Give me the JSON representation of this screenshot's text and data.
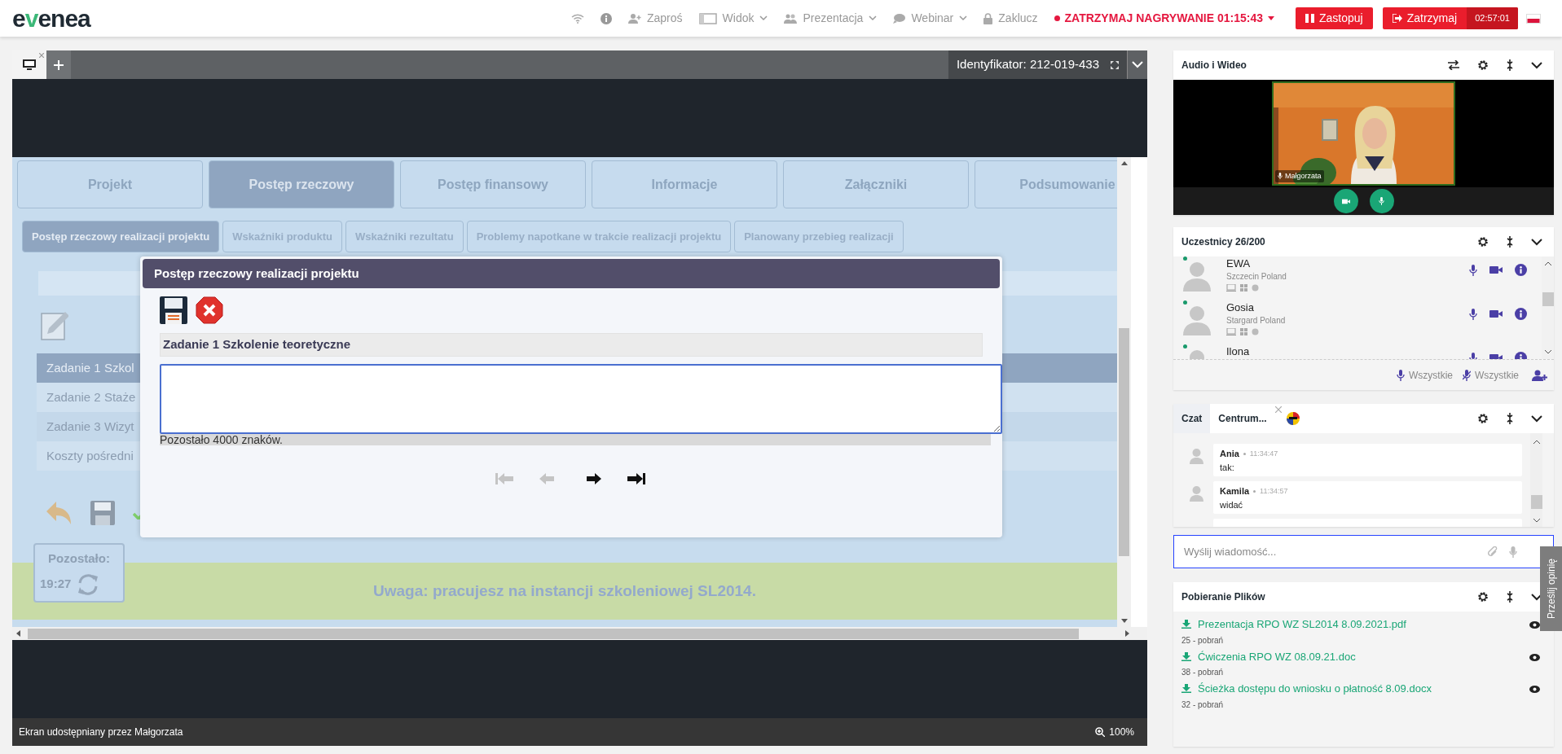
{
  "header": {
    "logo": [
      {
        "text": "e",
        "accent": false
      },
      {
        "text": "v",
        "accent": true
      },
      {
        "text": "enea",
        "accent": false
      }
    ],
    "nav": [
      {
        "kind": "wifi"
      },
      {
        "kind": "info"
      },
      {
        "kind": "invite",
        "label": "Zaproś",
        "dropdown": false
      },
      {
        "kind": "view",
        "label": "Widok",
        "dropdown": true
      },
      {
        "kind": "presentation",
        "label": "Prezentacja",
        "dropdown": true
      },
      {
        "kind": "webinar",
        "label": "Webinar",
        "dropdown": true
      },
      {
        "kind": "lock",
        "label": "Zaklucz",
        "dropdown": false
      }
    ],
    "recording": "ZATRZYMAJ NAGRYWANIE 01:15:43",
    "buttons": [
      {
        "kind": "pause",
        "label": "Zastopuj"
      },
      {
        "kind": "stop",
        "label": "Zatrzymaj",
        "timer": "02:57:01"
      }
    ]
  },
  "share": {
    "identifier": "Identyfikator: 212-019-433",
    "footer": "Ekran udostępniany przez Małgorzata",
    "zoom": "100%",
    "app": {
      "tabs": [
        {
          "label": "Projekt",
          "selected": false
        },
        {
          "label": "Postęp rzeczowy",
          "selected": true
        },
        {
          "label": "Postęp finansowy",
          "selected": false
        },
        {
          "label": "Informacje",
          "selected": false
        },
        {
          "label": "Załączniki",
          "selected": false
        },
        {
          "label": "Podsumowanie",
          "selected": false
        }
      ],
      "subtabs": [
        {
          "label": "Postęp rzeczowy realizacji projektu",
          "selected": true
        },
        {
          "label": "Wskaźniki produktu",
          "selected": false
        },
        {
          "label": "Wskaźniki rezultatu",
          "selected": false
        },
        {
          "label": "Problemy napotkane w trakcie realizacji projektu",
          "selected": false
        },
        {
          "label": "Planowany przebieg realizacji",
          "selected": false
        }
      ],
      "rows": [
        {
          "label": "Zadanie 1 Szkol",
          "selected": true
        },
        {
          "label": "Zadanie 2 Staże",
          "selected": false
        },
        {
          "label": "Zadanie 3 Wizyt",
          "selected": false
        },
        {
          "label": "Koszty pośredni",
          "selected": false
        }
      ],
      "timer_label": "Pozostało:",
      "timer": "19:27",
      "notice": "Uwaga: pracujesz na instancji szkoleniowej SL2014.",
      "dialog": {
        "title": "Postęp rzeczowy realizacji projektu",
        "field_label": "Zadanie 1 Szkolenie teoretyczne",
        "remaining": "Pozostało 4000 znaków.",
        "nav": [
          {
            "kind": "first",
            "disabled": true
          },
          {
            "kind": "prev",
            "disabled": true
          },
          {
            "kind": "next",
            "disabled": false
          },
          {
            "kind": "last",
            "disabled": false
          }
        ]
      }
    }
  },
  "audio": {
    "title": "Audio i Wideo",
    "video_name": "Małgorzata"
  },
  "participants": {
    "title": "Uczestnicy 26/200",
    "people": [
      {
        "name": "EWA",
        "location": "Szczecin Poland",
        "online": true
      },
      {
        "name": "Gosia",
        "location": "Stargard Poland",
        "online": true
      },
      {
        "name": "Ilona",
        "online": true
      }
    ],
    "actions": [
      {
        "kind": "mic",
        "label": "Wszystkie"
      },
      {
        "kind": "mic-off",
        "label": "Wszystkie"
      }
    ]
  },
  "chat": {
    "tabs": [
      {
        "label": "Czat",
        "selected": true,
        "closable": false
      },
      {
        "label": "Centrum...",
        "selected": false,
        "closable": true
      }
    ],
    "messages": [
      {
        "author": "Ania",
        "time": "11:34:47",
        "text": "tak:"
      },
      {
        "author": "Kamila",
        "time": "11:34:57",
        "text": "widać"
      }
    ],
    "placeholder": "Wyślij wiadomość..."
  },
  "feedback": "Prześlij opinię",
  "files": {
    "title": "Pobieranie Plików",
    "items": [
      {
        "name": "Prezentacja RPO WZ SL2014 8.09.2021.pdf",
        "count": "25 - pobrań"
      },
      {
        "name": "Ćwiczenia RPO WZ 08.09.21.doc",
        "count": "38 - pobrań"
      },
      {
        "name": "Ścieżka dostępu do wniosku o płatność 8.09.docx",
        "count": "32 - pobrań"
      }
    ]
  }
}
